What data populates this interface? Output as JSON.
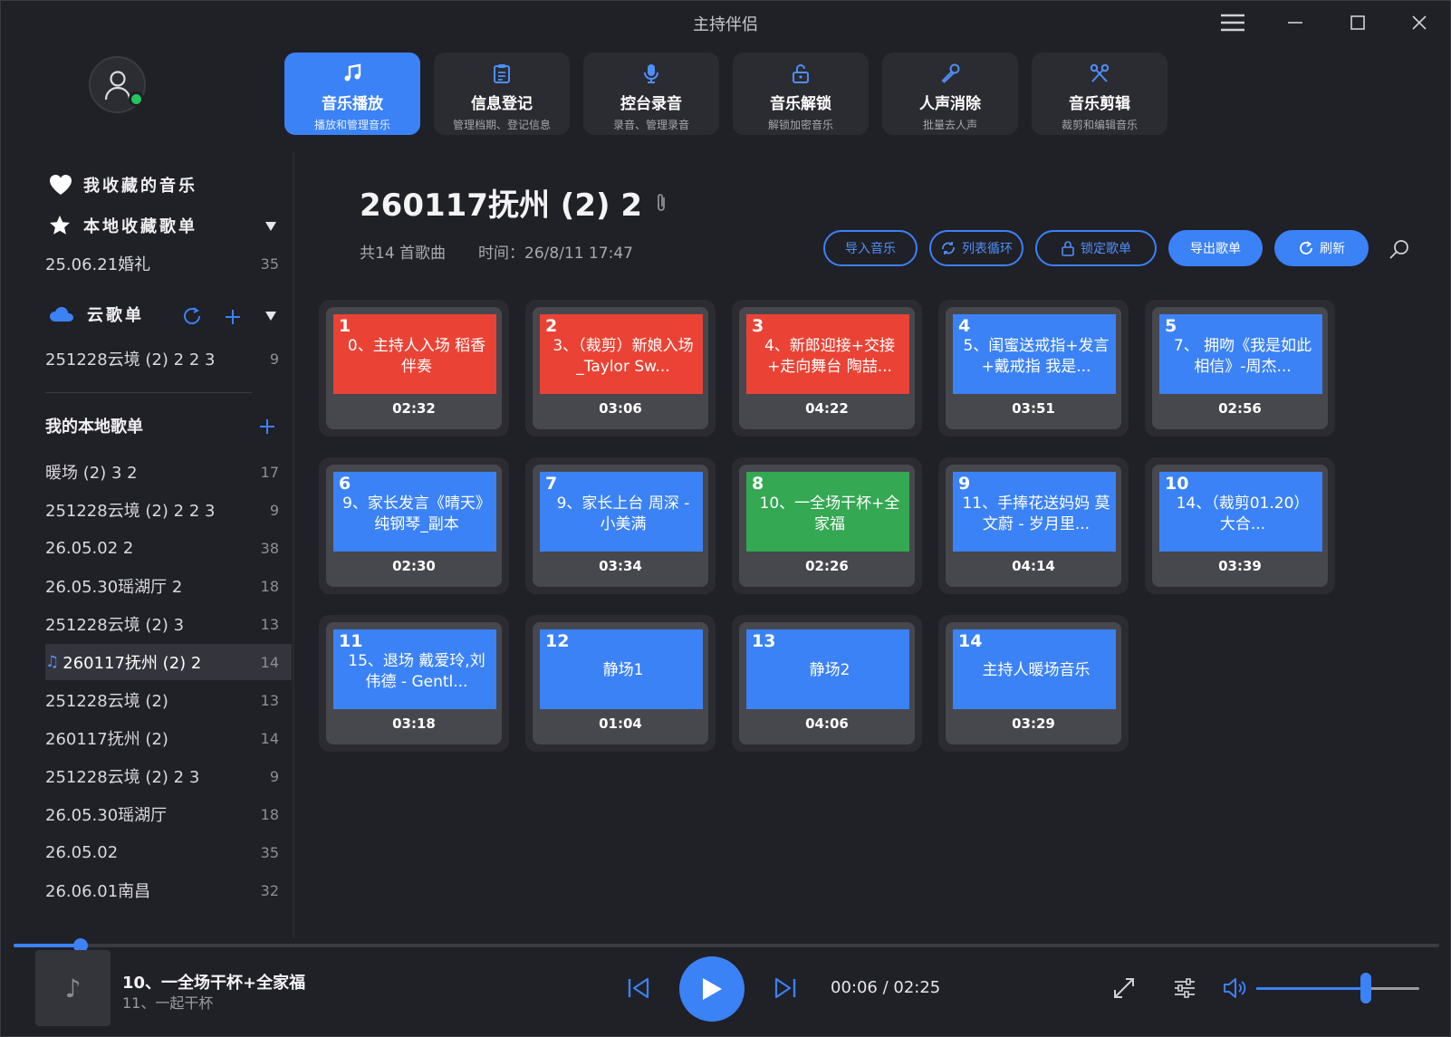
{
  "app": {
    "title": "主持伴侣"
  },
  "nav": {
    "tabs": [
      {
        "label": "音乐播放",
        "sub": "播放和管理音乐",
        "icon": "music-note-icon",
        "active": true
      },
      {
        "label": "信息登记",
        "sub": "管理档期、登记信息",
        "icon": "clipboard-icon",
        "active": false
      },
      {
        "label": "控台录音",
        "sub": "录音、管理录音",
        "icon": "microphone-icon",
        "active": false
      },
      {
        "label": "音乐解锁",
        "sub": "解锁加密音乐",
        "icon": "unlock-icon",
        "active": false
      },
      {
        "label": "人声消除",
        "sub": "批量去人声",
        "icon": "mic-pen-icon",
        "active": false
      },
      {
        "label": "音乐剪辑",
        "sub": "裁剪和编辑音乐",
        "icon": "scissors-icon",
        "active": false
      }
    ]
  },
  "sidebar": {
    "favorites_label": "我收藏的音乐",
    "local_fav_label": "本地收藏歌单",
    "local_fav_items": [
      {
        "label": "25.06.21婚礼",
        "count": "35"
      }
    ],
    "cloud_label": "云歌单",
    "cloud_items": [
      {
        "label": "251228云境 (2) 2 2 3",
        "count": "9"
      }
    ],
    "my_local_label": "我的本地歌单",
    "my_local_items": [
      {
        "label": "暖场 (2) 3 2",
        "count": "17"
      },
      {
        "label": "251228云境 (2) 2 2 3",
        "count": "9"
      },
      {
        "label": "26.05.02 2",
        "count": "38"
      },
      {
        "label": "26.05.30瑶湖厅 2",
        "count": "18"
      },
      {
        "label": "251228云境 (2) 3",
        "count": "13"
      },
      {
        "label": "260117抚州 (2) 2",
        "count": "14",
        "active": true
      },
      {
        "label": "251228云境 (2)",
        "count": "13"
      },
      {
        "label": "260117抚州 (2)",
        "count": "14"
      },
      {
        "label": "251228云境 (2) 2 3",
        "count": "9"
      },
      {
        "label": "26.05.30瑶湖厅",
        "count": "18"
      },
      {
        "label": "26.05.02",
        "count": "35"
      },
      {
        "label": "26.06.01南昌",
        "count": "32"
      }
    ]
  },
  "playlist": {
    "title": "260117抚州 (2) 2",
    "song_count": "共14 首歌曲",
    "time": "时间：26/8/11 17:47",
    "actions": {
      "import": "导入音乐",
      "loop": "列表循环",
      "lock": "锁定歌单",
      "export": "导出歌单",
      "refresh": "刷新"
    }
  },
  "songs": [
    {
      "num": "1",
      "name": "0、主持人入场 稻香 伴奏",
      "dur": "02:32",
      "color": "red"
    },
    {
      "num": "2",
      "name": "3、（裁剪）新娘入场_Taylor Sw...",
      "dur": "03:06",
      "color": "red"
    },
    {
      "num": "3",
      "name": "4、新郎迎接+交接+走向舞台 陶喆...",
      "dur": "04:22",
      "color": "red"
    },
    {
      "num": "4",
      "name": "5、闺蜜送戒指+发言+戴戒指 我是...",
      "dur": "03:51",
      "color": "blue"
    },
    {
      "num": "5",
      "name": "7、 拥吻《我是如此相信》-周杰...",
      "dur": "02:56",
      "color": "blue"
    },
    {
      "num": "6",
      "name": "9、家长发言《晴天》纯钢琴_副本",
      "dur": "02:30",
      "color": "blue"
    },
    {
      "num": "7",
      "name": "9、家长上台 周深 - 小美满",
      "dur": "03:34",
      "color": "blue"
    },
    {
      "num": "8",
      "name": "10、一全场干杯+全家福",
      "dur": "02:26",
      "color": "green"
    },
    {
      "num": "9",
      "name": "11、手捧花送妈妈 莫文蔚 - 岁月里...",
      "dur": "04:14",
      "color": "blue"
    },
    {
      "num": "10",
      "name": "14、（裁剪01.20） 大合...",
      "dur": "03:39",
      "color": "blue"
    },
    {
      "num": "11",
      "name": "15、退场 戴爱玲,刘伟德 - Gentl...",
      "dur": "03:18",
      "color": "blue"
    },
    {
      "num": "12",
      "name": "静场1",
      "dur": "01:04",
      "color": "blue"
    },
    {
      "num": "13",
      "name": "静场2",
      "dur": "04:06",
      "color": "blue"
    },
    {
      "num": "14",
      "name": "主持人暖场音乐",
      "dur": "03:29",
      "color": "blue"
    }
  ],
  "player": {
    "now_title": "10、一全场干杯+全家福",
    "next_title": "11、一起干杯",
    "time": "00:06 / 02:25",
    "progress_pct": 4.7,
    "volume_pct": 67,
    "cover_icon": "music-note-icon"
  },
  "colors": {
    "accent": "#3b82f6",
    "red": "#ea4335",
    "green": "#34a853",
    "online": "#22c55e"
  }
}
